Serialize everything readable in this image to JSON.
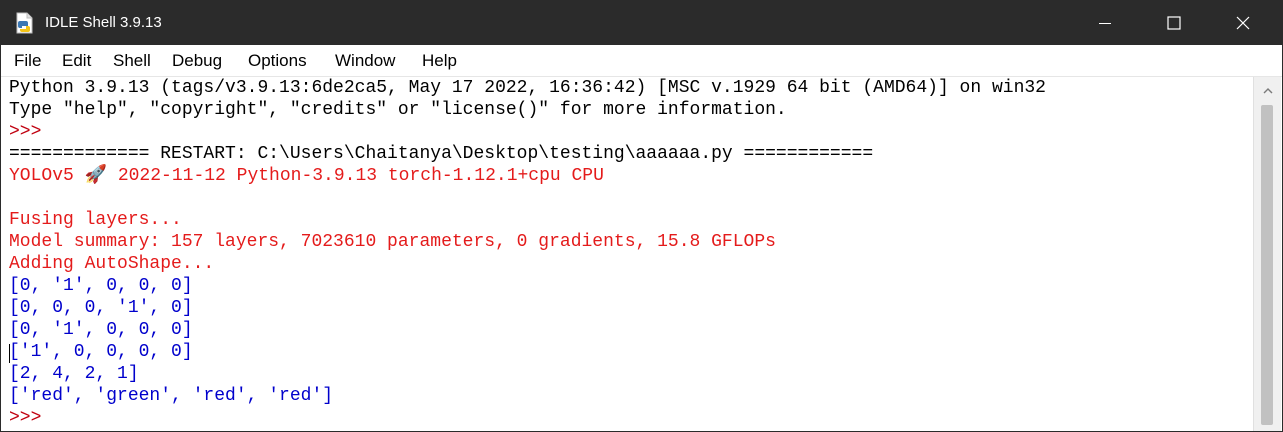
{
  "window": {
    "title": "IDLE Shell 3.9.13"
  },
  "menu": {
    "items": [
      "File",
      "Edit",
      "Shell",
      "Debug",
      "Options",
      "Window",
      "Help"
    ]
  },
  "shell": {
    "lines": [
      "Python 3.9.13 (tags/v3.9.13:6de2ca5, May 17 2022, 16:36:42) [MSC v.1929 64 bit (AMD64)] on win32",
      "Type \"help\", \"copyright\", \"credits\" or \"license()\" for more information.",
      ">>> ",
      "============= RESTART: C:\\Users\\Chaitanya\\Desktop\\testing\\aaaaaa.py ============",
      "YOLOv5 🚀 2022-11-12 Python-3.9.13 torch-1.12.1+cpu CPU",
      "",
      "Fusing layers... ",
      "Model summary: 157 layers, 7023610 parameters, 0 gradients, 15.8 GFLOPs",
      "Adding AutoShape... ",
      "[0, '1', 0, 0, 0]",
      "[0, 0, 0, '1', 0]",
      "[0, '1', 0, 0, 0]",
      "['1', 0, 0, 0, 0]",
      "[2, 4, 2, 1]",
      "['red', 'green', 'red', 'red']",
      ">>> "
    ]
  },
  "colors": {
    "titlebar": "#2b2b2b",
    "prompt": "#c0000f",
    "stderr": "#e41b1b",
    "stdout": "#0000cc",
    "normal": "#000000"
  }
}
